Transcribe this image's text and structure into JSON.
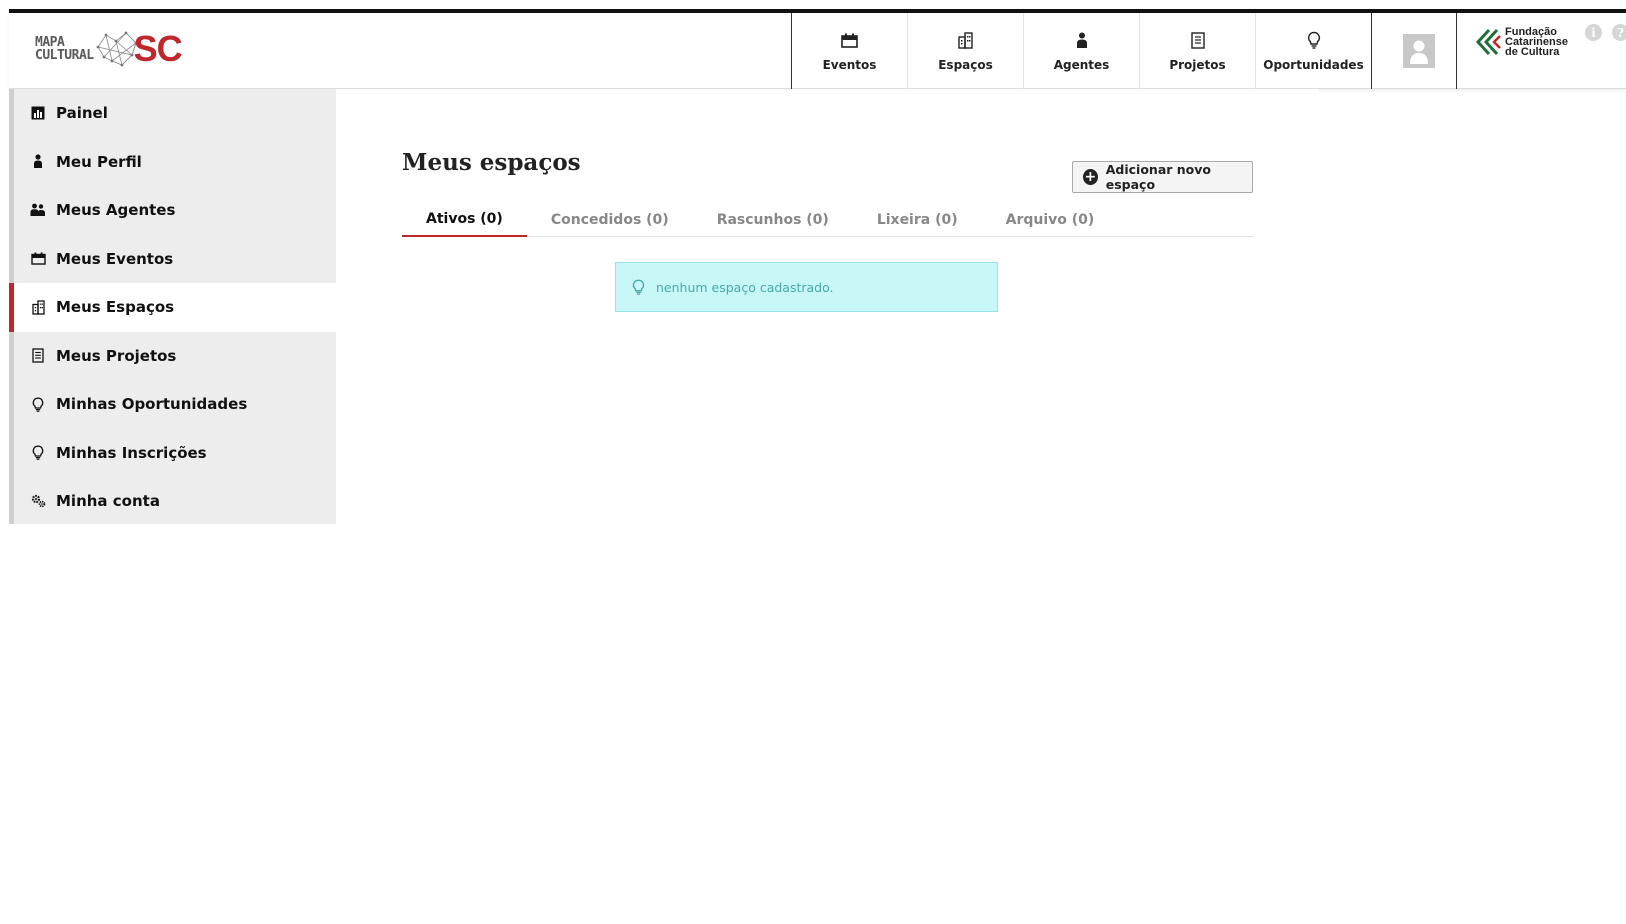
{
  "header": {
    "logo": {
      "line1": "MAPA",
      "line2": "CULTURAL",
      "suffix": "SC"
    },
    "nav": [
      {
        "label": "Eventos",
        "icon": "calendar-icon"
      },
      {
        "label": "Espaços",
        "icon": "building-icon"
      },
      {
        "label": "Agentes",
        "icon": "person-icon"
      },
      {
        "label": "Projetos",
        "icon": "document-icon"
      },
      {
        "label": "Oportunidades",
        "icon": "lightbulb-icon"
      }
    ],
    "partner_logo": {
      "line1": "Fundação",
      "line2": "Catarinense",
      "line3": "de Cultura"
    },
    "info_icon": "i",
    "help_icon": "?"
  },
  "sidebar": {
    "items": [
      {
        "label": "Painel",
        "icon": "dashboard-icon"
      },
      {
        "label": "Meu Perfil",
        "icon": "person-icon"
      },
      {
        "label": "Meus Agentes",
        "icon": "people-icon"
      },
      {
        "label": "Meus Eventos",
        "icon": "calendar-icon"
      },
      {
        "label": "Meus Espaços",
        "icon": "building-icon",
        "active": true
      },
      {
        "label": "Meus Projetos",
        "icon": "document-icon"
      },
      {
        "label": "Minhas Oportunidades",
        "icon": "lightbulb-icon"
      },
      {
        "label": "Minhas Inscrições",
        "icon": "lightbulb-icon"
      },
      {
        "label": "Minha conta",
        "icon": "gears-icon"
      }
    ]
  },
  "main": {
    "title": "Meus espaços",
    "add_button": "Adicionar novo espaço",
    "tabs": [
      {
        "label": "Ativos (0)",
        "active": true
      },
      {
        "label": "Concedidos (0)"
      },
      {
        "label": "Rascunhos (0)"
      },
      {
        "label": "Lixeira (0)"
      },
      {
        "label": "Arquivo (0)"
      }
    ],
    "alert": "nenhum espaço cadastrado."
  },
  "colors": {
    "accent": "#c0272d",
    "alert_bg": "#c8f7f7",
    "alert_text": "#4aa8a8",
    "page_bg": "#ededed"
  }
}
